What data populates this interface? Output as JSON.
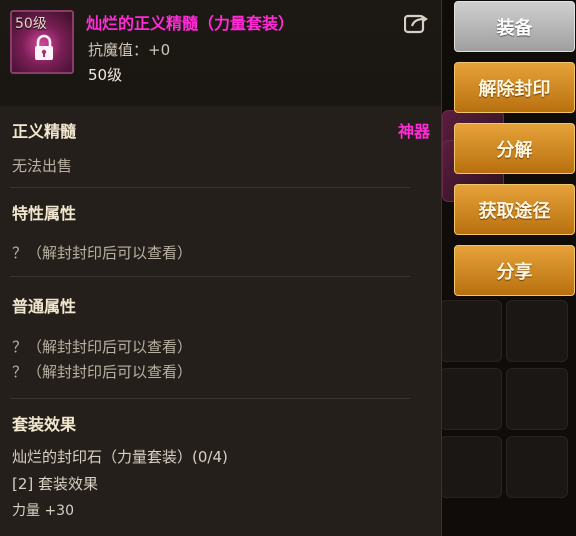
{
  "item": {
    "icon_level": "50级",
    "title": "灿烂的正义精髓（力量套装）",
    "resist": "抗魔值：+0",
    "level": "50级",
    "lock_icon": "lock-icon",
    "share_icon": "share-icon"
  },
  "sections": {
    "type_label": "正义精髓",
    "grade": "神器",
    "sell": "无法出售",
    "special_title": "特性属性",
    "special_text": "？（解封封印后可以查看）",
    "normal_title": "普通属性",
    "normal_lines": [
      "？（解封封印后可以查看）",
      "？（解封封印后可以查看）"
    ],
    "set_title": "套装效果",
    "set_name": "灿烂的封印石（力量套装）(0/4)",
    "set_effect": "[2] 套装效果",
    "set_bonus": "力量 +30"
  },
  "buttons": [
    "装备",
    "解除封印",
    "分解",
    "获取途径",
    "分享"
  ],
  "colors": {
    "title_magenta": "#ff2bd6",
    "button_gold": "#d48a22",
    "button_gray": "#b5b5b5"
  }
}
